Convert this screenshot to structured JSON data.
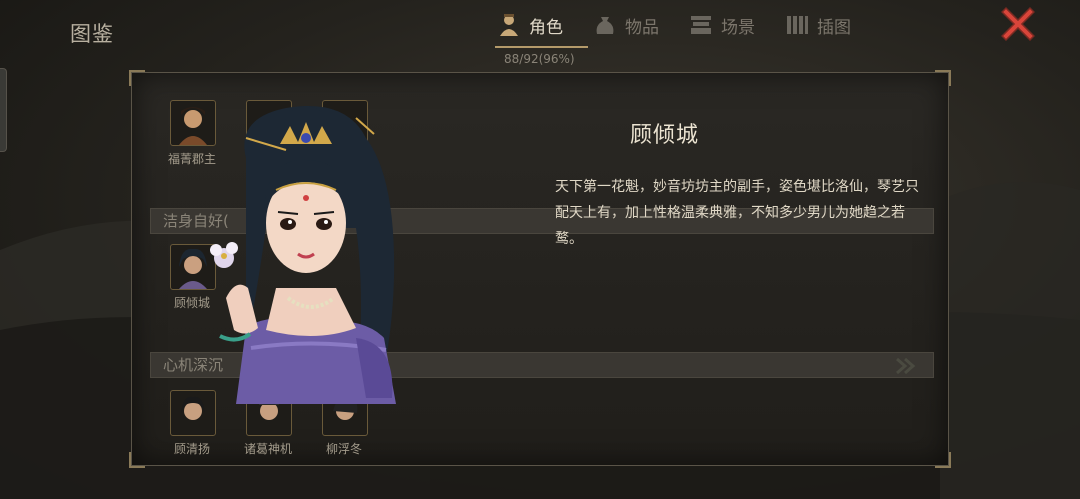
{
  "header": {
    "title": "图鉴",
    "tabs": [
      {
        "label": "角色",
        "icon": "person-icon",
        "active": true
      },
      {
        "label": "物品",
        "icon": "bag-icon",
        "active": false
      },
      {
        "label": "场景",
        "icon": "building-icon",
        "active": false
      },
      {
        "label": "插图",
        "icon": "scroll-icon",
        "active": false
      }
    ],
    "counter": "88/92(96%)"
  },
  "groups": [
    {
      "label": "洁身自好("
    },
    {
      "label": "心机深沉"
    }
  ],
  "slots": [
    {
      "label": "福菁郡主"
    },
    {
      "label": "顾倾城"
    },
    {
      "label": "顾清扬"
    },
    {
      "label": "诸葛神机"
    },
    {
      "label": "柳浮冬"
    }
  ],
  "detail": {
    "name": "顾倾城",
    "description": "天下第一花魁，妙音坊坊主的副手，姿色堪比洛仙，琴艺只配天上有，加上性格温柔典雅，不知多少男儿为她趋之若鹜。"
  },
  "colors": {
    "accent": "#b49a6a",
    "close": "#d8453a",
    "panel_border": "#5a5448"
  }
}
